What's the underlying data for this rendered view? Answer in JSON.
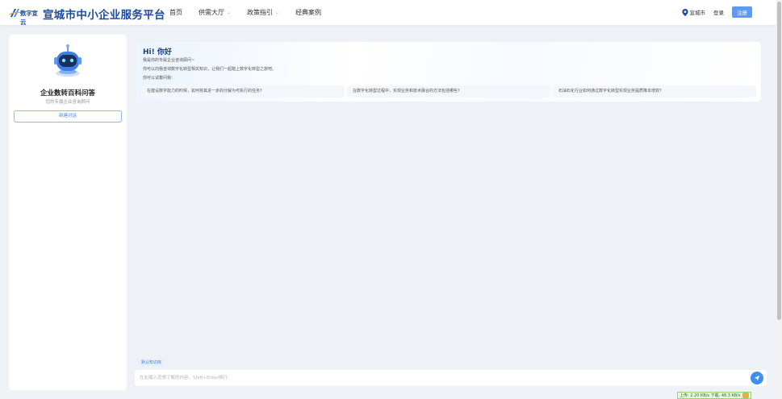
{
  "header": {
    "logo_text": "数字宣云",
    "site_title": "宣城市中小企业服务平台",
    "nav": [
      {
        "label": "首页",
        "has_dropdown": false
      },
      {
        "label": "供需大厅",
        "has_dropdown": true
      },
      {
        "label": "政策指引",
        "has_dropdown": true
      },
      {
        "label": "经典案例",
        "has_dropdown": false
      }
    ],
    "location": "宣城市",
    "login": "登录",
    "register": "注册"
  },
  "sidebar": {
    "bot_name": "企业数转百科问答",
    "bot_desc": "您的专属企业咨询顾问",
    "new_chat": "新建对话"
  },
  "welcome": {
    "greeting": "Hi! 你好",
    "line1": "我是你的专属企业咨询顾问~",
    "line2": "你可以向我咨询数字化转型相关知识，让我们一起踏上数字化转型之旅吧。",
    "line3": "你可以试着问我：",
    "suggestions": [
      "在建设数字能力的时候，如何将其进一步的分解为可执行的任务?",
      "在数字化转型过程中，实现业务和技术融合的方法包括哪些?",
      "石油石化行业如何通过数字化转型实现业务提质降本增效?"
    ]
  },
  "input": {
    "kb_tag": "默认知识库",
    "placeholder": "在此输入您想了解的内容，Shift+Enter换行",
    "value": ""
  },
  "net_stats": {
    "text": "上传: 2.20 KB/s   下载: 48.3 KB/s"
  },
  "colors": {
    "brand_title": "#1e4b9c",
    "accent": "#3d8ef7",
    "register_bg": "#5b9bf5",
    "page_bg": "#eef1f6"
  }
}
